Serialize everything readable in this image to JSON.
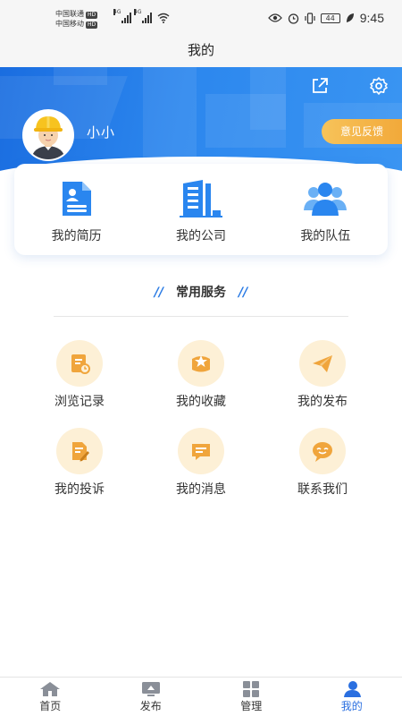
{
  "status_bar": {
    "carrier_1": "中国联通",
    "carrier_2": "中国移动",
    "hd_badge": "HD",
    "network_1": "4G",
    "network_2": "4G",
    "battery": "44",
    "time": "9:45"
  },
  "header": {
    "title": "我的"
  },
  "profile": {
    "username": "小小",
    "feedback_label": "意见反馈"
  },
  "quick_links": [
    {
      "label": "我的简历",
      "icon": "resume-icon"
    },
    {
      "label": "我的公司",
      "icon": "company-building-icon"
    },
    {
      "label": "我的队伍",
      "icon": "team-icon"
    }
  ],
  "services": {
    "title": "常用服务",
    "decor": "//",
    "items": [
      {
        "label": "浏览记录",
        "icon": "history-icon"
      },
      {
        "label": "我的收藏",
        "icon": "favorite-icon"
      },
      {
        "label": "我的发布",
        "icon": "send-icon"
      },
      {
        "label": "我的投诉",
        "icon": "complaint-icon"
      },
      {
        "label": "我的消息",
        "icon": "message-icon"
      },
      {
        "label": "联系我们",
        "icon": "contact-icon"
      }
    ]
  },
  "tabbar": {
    "items": [
      {
        "label": "首页",
        "icon": "home-icon"
      },
      {
        "label": "发布",
        "icon": "publish-icon"
      },
      {
        "label": "管理",
        "icon": "manage-icon"
      },
      {
        "label": "我的",
        "icon": "profile-icon"
      }
    ],
    "active_index": 3
  },
  "colors": {
    "primary": "#2a7be4",
    "accent_orange": "#f2a93a",
    "service_bg": "#fdf0d6",
    "service_icon": "#f0a53c"
  }
}
